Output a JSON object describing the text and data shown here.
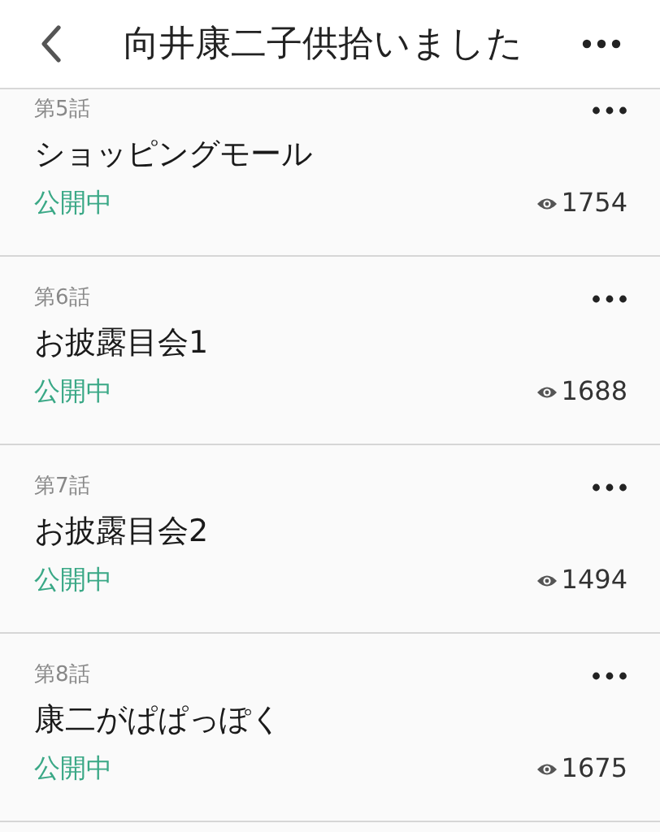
{
  "header": {
    "title": "向井康二子供拾いました"
  },
  "episodes": [
    {
      "number": "第5話",
      "title": "ショッピングモール",
      "status": "公開中",
      "views": "1754"
    },
    {
      "number": "第6話",
      "title": "お披露目会1",
      "status": "公開中",
      "views": "1688"
    },
    {
      "number": "第7話",
      "title": "お披露目会2",
      "status": "公開中",
      "views": "1494"
    },
    {
      "number": "第8話",
      "title": "康二がぱぱっぽく",
      "status": "公開中",
      "views": "1675"
    }
  ]
}
